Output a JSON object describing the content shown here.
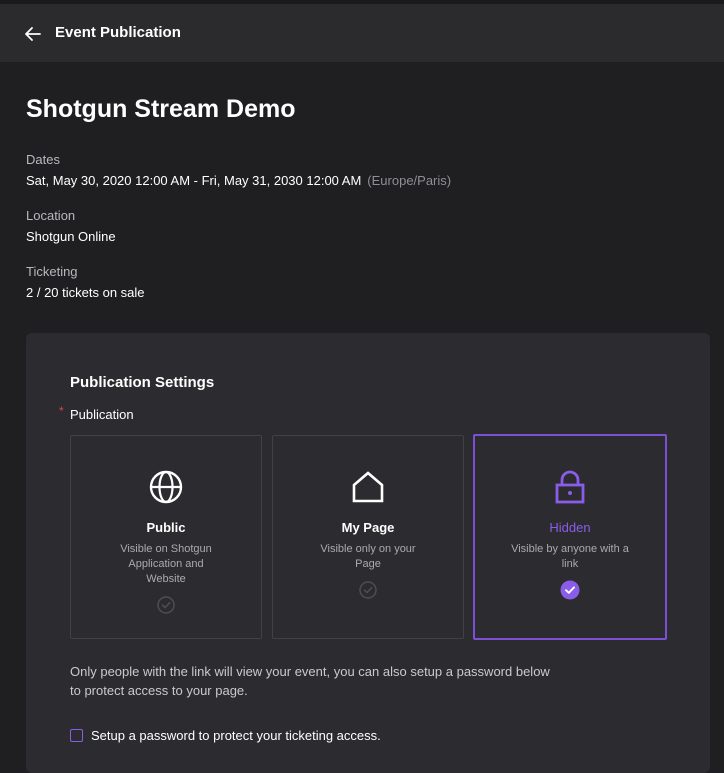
{
  "header": {
    "title": "Event Publication"
  },
  "event": {
    "name": "Shotgun Stream Demo",
    "dates_label": "Dates",
    "dates_value": "Sat, May 30, 2020 12:00 AM - Fri, May 31, 2030 12:00 AM",
    "timezone": "(Europe/Paris)",
    "location_label": "Location",
    "location_value": "Shotgun Online",
    "ticketing_label": "Ticketing",
    "ticketing_value": "2 / 20 tickets on sale"
  },
  "settings": {
    "title": "Publication Settings",
    "required_mark": "*",
    "publication_label": "Publication",
    "options": [
      {
        "title": "Public",
        "description": "Visible on Shotgun Application and Website",
        "icon": "globe-icon",
        "selected": false
      },
      {
        "title": "My Page",
        "description": "Visible only on your Page",
        "icon": "home-icon",
        "selected": false
      },
      {
        "title": "Hidden",
        "description": "Visible by anyone with a link",
        "icon": "lock-icon",
        "selected": true
      }
    ],
    "help_text": "Only people with the link will view your event, you can also setup a password below to protect access to your page.",
    "password_checkbox_label": "Setup a password to protect your ticketing access.",
    "password_checkbox_checked": false
  },
  "colors": {
    "accent": "#8a5de8",
    "background": "#1f1f22",
    "panel": "#2c2c30",
    "required": "#e0424f"
  }
}
